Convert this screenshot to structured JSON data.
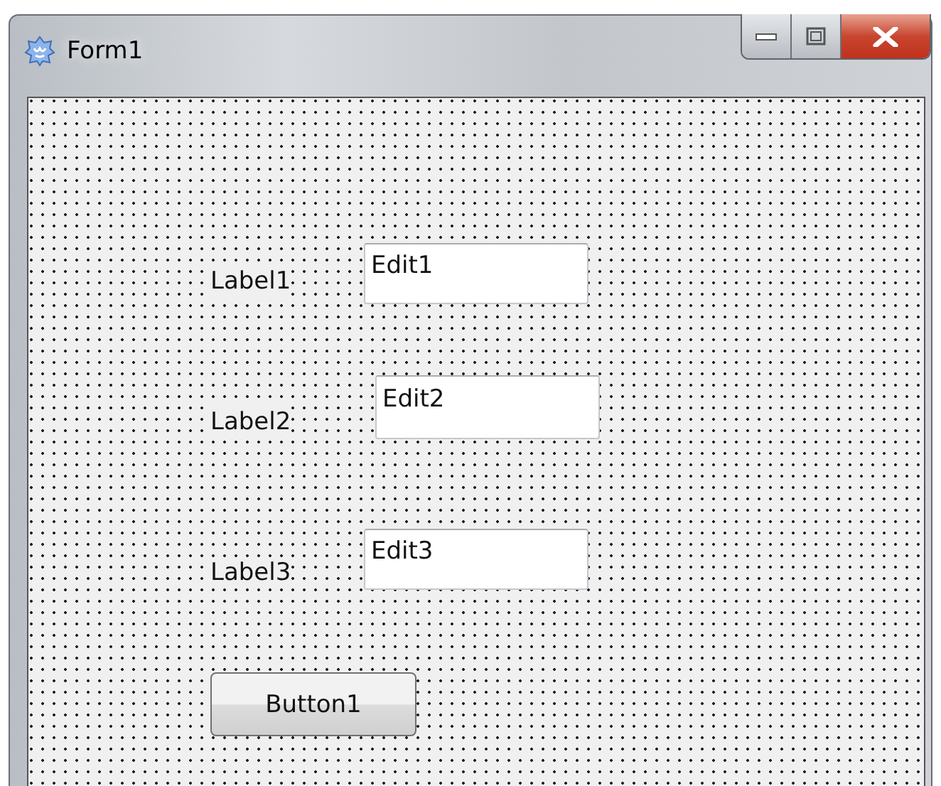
{
  "window": {
    "title": "Form1"
  },
  "components": [
    {
      "kind": "label",
      "text": "Label1"
    },
    {
      "kind": "edit",
      "text": "Edit1"
    },
    {
      "kind": "label",
      "text": "Label2"
    },
    {
      "kind": "edit",
      "text": "Edit2"
    },
    {
      "kind": "label",
      "text": "Label3"
    },
    {
      "kind": "edit",
      "text": "Edit3"
    },
    {
      "kind": "button",
      "text": "Button1"
    }
  ]
}
